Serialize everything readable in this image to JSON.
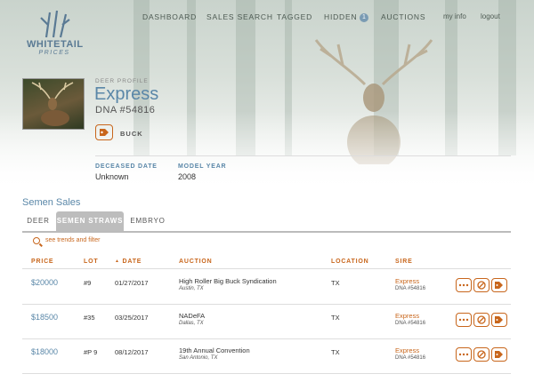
{
  "logo": {
    "brand": "WHITETAIL",
    "sub": "PRICES"
  },
  "nav": {
    "dashboard": "DASHBOARD",
    "semen_search": "SALES SEARCH",
    "tagged": "TAGGED",
    "hidden": "HIDDEN",
    "hidden_count": "1",
    "auctions": "AUCTIONS",
    "my_info": "my info",
    "logout": "logout"
  },
  "profile": {
    "kicker": "DEER PROFILE",
    "name": "Express",
    "dna": "DNA #54816",
    "category": "BUCK"
  },
  "details": {
    "deceased_label": "DECEASED DATE",
    "deceased_value": "Unknown",
    "model_label": "MODEL YEAR",
    "model_value": "2008"
  },
  "sales": {
    "title": "Semen Sales",
    "tabs": [
      "DEER",
      "SEMEN STRAWS",
      "EMBRYO"
    ],
    "filter": "see trends and filter",
    "columns": [
      "PRICE",
      "LOT",
      "DATE",
      "AUCTION",
      "LOCATION",
      "SIRE"
    ],
    "sort_indicator": "▲",
    "rows": [
      {
        "price": "$20000",
        "lot": "#9",
        "date": "01/27/2017",
        "auction": "High Roller Big Buck Syndication",
        "city": "Austin, TX",
        "location": "TX",
        "sire": "Express",
        "sire_dna": "DNA #54816"
      },
      {
        "price": "$18500",
        "lot": "#35",
        "date": "03/25/2017",
        "auction": "NADeFA",
        "city": "Dallas, TX",
        "location": "TX",
        "sire": "Express",
        "sire_dna": "DNA #54816"
      },
      {
        "price": "$18000",
        "lot": "#P 9",
        "date": "08/12/2017",
        "auction": "19th Annual Convention",
        "city": "San Antonio, TX",
        "location": "TX",
        "sire": "Express",
        "sire_dna": "DNA #54816"
      }
    ]
  },
  "colors": {
    "accent": "#c8661c",
    "link": "#5a87a8"
  }
}
